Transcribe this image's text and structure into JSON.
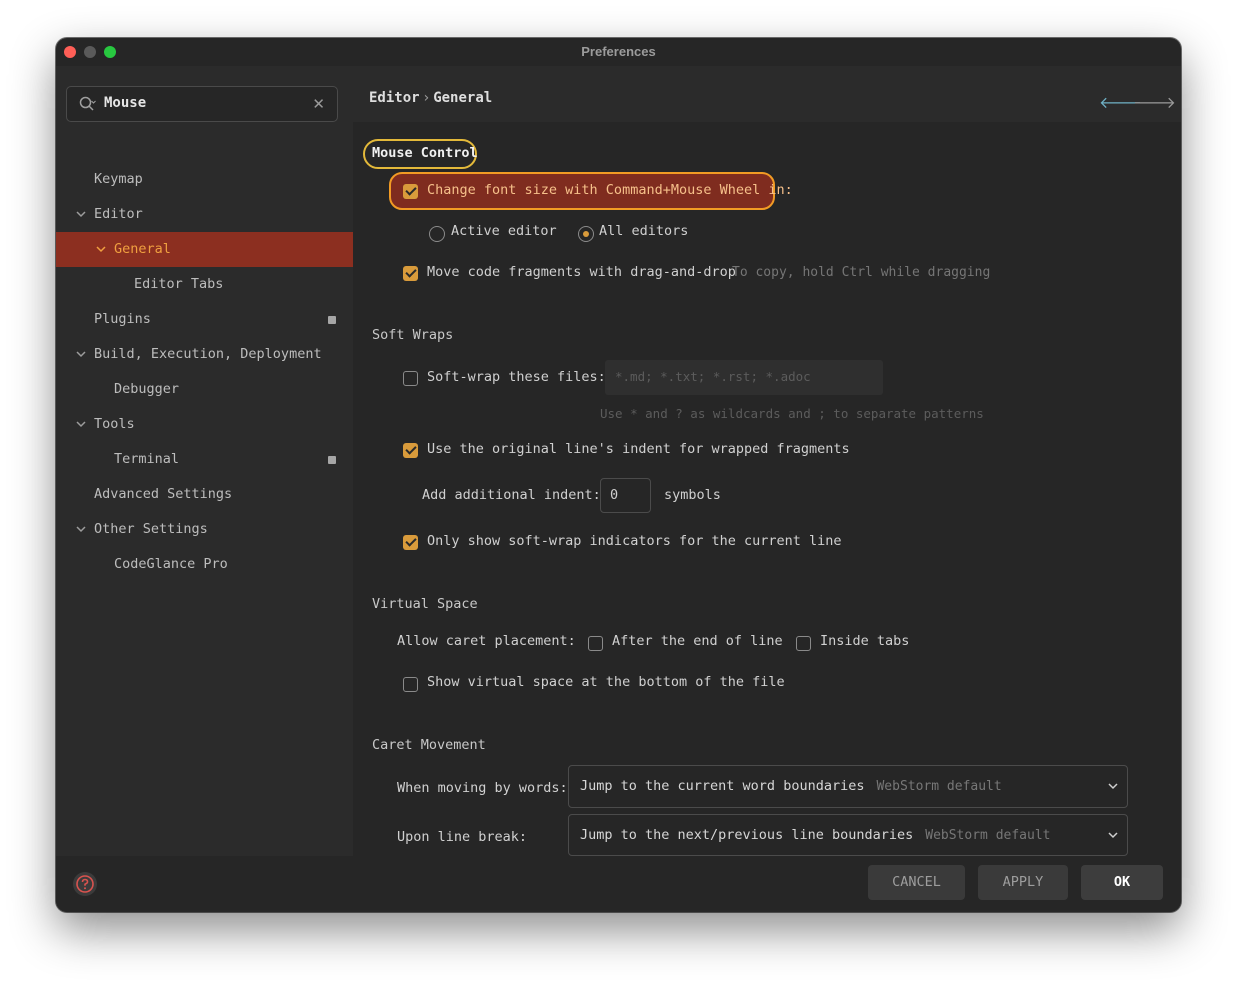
{
  "window": {
    "title": "Preferences"
  },
  "search": {
    "value": "Mouse",
    "icon": "search-icon",
    "clear_icon": "close-icon"
  },
  "sidebar": {
    "items": [
      {
        "label": "Keymap",
        "chevron": ""
      },
      {
        "label": "Editor",
        "chevron": "⌄"
      },
      {
        "label": "General",
        "chevron": "⌄",
        "selected": true
      },
      {
        "label": "Editor Tabs",
        "chevron": ""
      },
      {
        "label": "Plugins",
        "chevron": "",
        "badge": true
      },
      {
        "label": "Build, Execution, Deployment",
        "chevron": "⌄"
      },
      {
        "label": "Debugger",
        "chevron": ""
      },
      {
        "label": "Tools",
        "chevron": "⌄"
      },
      {
        "label": "Terminal",
        "chevron": "",
        "badge": true
      },
      {
        "label": "Advanced Settings",
        "chevron": ""
      },
      {
        "label": "Other Settings",
        "chevron": "⌄"
      },
      {
        "label": "CodeGlance Pro",
        "chevron": ""
      }
    ]
  },
  "breadcrumb": {
    "parent": "Editor",
    "separator": "›",
    "current": "General"
  },
  "mouse_control": {
    "title": "Mouse Control",
    "change_font": {
      "label": "Change font size with Command+Mouse Wheel in:",
      "checked": true
    },
    "radio_active": {
      "label": "Active editor",
      "selected": false
    },
    "radio_all": {
      "label": "All editors",
      "selected": true
    },
    "drag_drop": {
      "label": "Move code fragments with drag-and-drop",
      "checked": true,
      "hint": "To copy, hold Ctrl while dragging"
    }
  },
  "soft_wraps": {
    "title": "Soft Wraps",
    "wrap_files": {
      "label": "Soft-wrap these files:",
      "checked": false,
      "placeholder": "*.md; *.txt; *.rst; *.adoc",
      "hint": "Use * and ? as wildcards and ; to separate patterns"
    },
    "original_indent": {
      "label": "Use the original line's indent for wrapped fragments",
      "checked": true
    },
    "additional_indent": {
      "label": "Add additional indent:",
      "value": "0",
      "unit": "symbols"
    },
    "indicators": {
      "label": "Only show soft-wrap indicators for the current line",
      "checked": true
    }
  },
  "virtual_space": {
    "title": "Virtual Space",
    "caret_label": "Allow caret placement:",
    "after_end": {
      "label": "After the end of line",
      "checked": false
    },
    "inside_tabs": {
      "label": "Inside tabs",
      "checked": false
    },
    "show_bottom": {
      "label": "Show virtual space at the bottom of the file",
      "checked": false
    }
  },
  "caret_movement": {
    "title": "Caret Movement",
    "words": {
      "label": "When moving by words:",
      "value": "Jump to the current word boundaries",
      "hint": "WebStorm default"
    },
    "line_break": {
      "label": "Upon line break:",
      "value": "Jump to the next/previous line boundaries",
      "hint": "WebStorm default"
    }
  },
  "footer": {
    "cancel": "CANCEL",
    "apply": "APPLY",
    "ok": "OK",
    "help_icon": "help-icon"
  },
  "colors": {
    "accent": "#d99b3b",
    "selection": "#8c2f20",
    "highlight_yellow": "#e3b93a",
    "highlight_orange": "#f29b24"
  }
}
